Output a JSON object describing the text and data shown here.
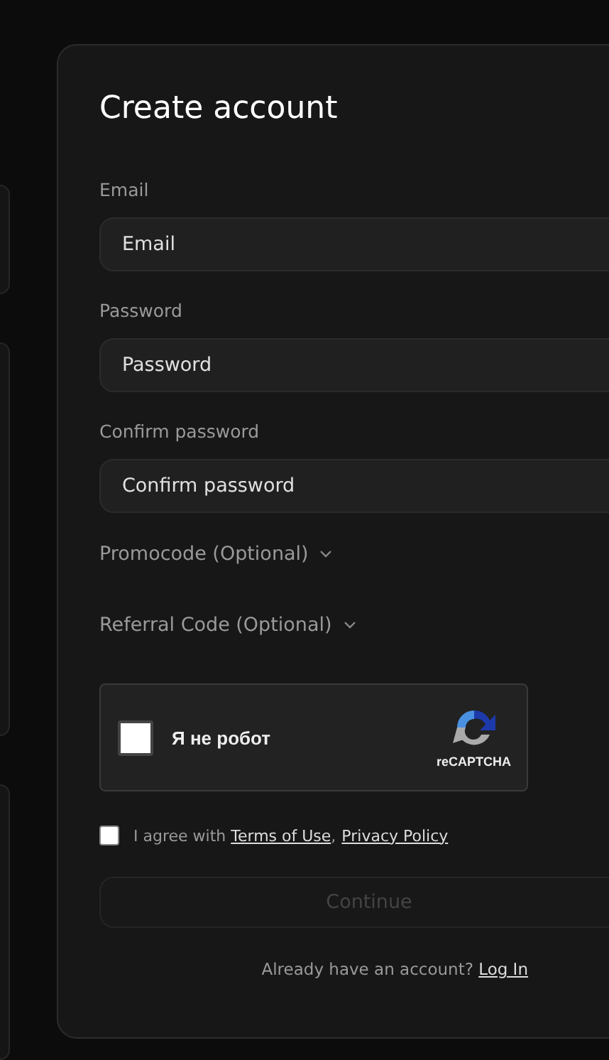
{
  "title": "Create account",
  "fields": [
    {
      "label": "Email",
      "placeholder": "Email"
    },
    {
      "label": "Password",
      "placeholder": "Password"
    },
    {
      "label": "Confirm password",
      "placeholder": "Confirm password"
    }
  ],
  "optional_sections": [
    {
      "label": "Promocode (Optional)",
      "expanded": false
    },
    {
      "label": "Referral Code (Optional)",
      "expanded": false
    }
  ],
  "captcha": {
    "label": "Я не робот",
    "checked": false,
    "brand": "reCAPTCHA"
  },
  "agreement": {
    "checked": false,
    "text": "I agree with",
    "links": [
      "Terms of Use",
      "Privacy Policy"
    ],
    "separator": ","
  },
  "continue_button": {
    "label": "Continue",
    "disabled": true
  },
  "login_prompt": {
    "text": "Already have an account?",
    "link": "Log In"
  }
}
